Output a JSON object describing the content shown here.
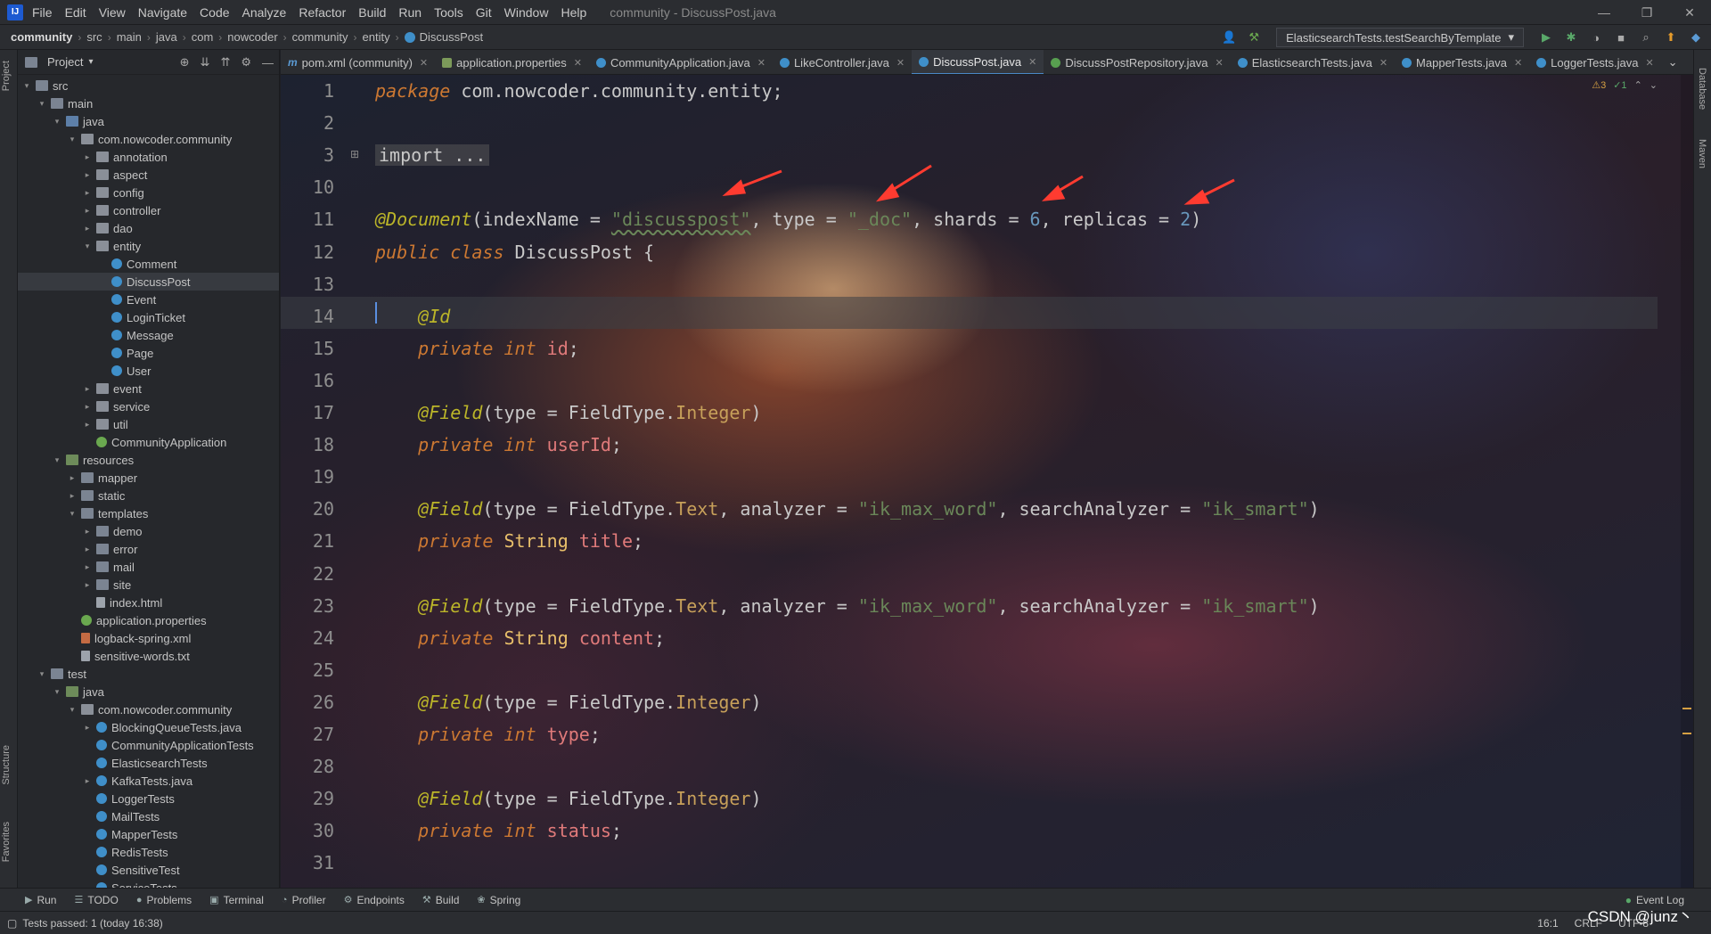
{
  "menu": {
    "items": [
      "File",
      "Edit",
      "View",
      "Navigate",
      "Code",
      "Analyze",
      "Refactor",
      "Build",
      "Run",
      "Tools",
      "Git",
      "Window",
      "Help"
    ],
    "title": "community - DiscussPost.java"
  },
  "breadcrumb": [
    "community",
    "src",
    "main",
    "java",
    "com",
    "nowcoder",
    "community",
    "entity",
    "DiscussPost"
  ],
  "run_config": "ElasticsearchTests.testSearchByTemplate",
  "project_panel": {
    "title": "Project",
    "tree": [
      {
        "label": "src",
        "indent": 0,
        "arrow": "▾",
        "icon": "folder"
      },
      {
        "label": "main",
        "indent": 1,
        "arrow": "▾",
        "icon": "folder"
      },
      {
        "label": "java",
        "indent": 2,
        "arrow": "▾",
        "icon": "src"
      },
      {
        "label": "com.nowcoder.community",
        "indent": 3,
        "arrow": "▾",
        "icon": "pkg"
      },
      {
        "label": "annotation",
        "indent": 4,
        "arrow": "▸",
        "icon": "pkg"
      },
      {
        "label": "aspect",
        "indent": 4,
        "arrow": "▸",
        "icon": "pkg"
      },
      {
        "label": "config",
        "indent": 4,
        "arrow": "▸",
        "icon": "pkg"
      },
      {
        "label": "controller",
        "indent": 4,
        "arrow": "▸",
        "icon": "pkg"
      },
      {
        "label": "dao",
        "indent": 4,
        "arrow": "▸",
        "icon": "pkg"
      },
      {
        "label": "entity",
        "indent": 4,
        "arrow": "▾",
        "icon": "pkg"
      },
      {
        "label": "Comment",
        "indent": 5,
        "arrow": "",
        "icon": "class"
      },
      {
        "label": "DiscussPost",
        "indent": 5,
        "arrow": "",
        "icon": "class",
        "selected": true
      },
      {
        "label": "Event",
        "indent": 5,
        "arrow": "",
        "icon": "class"
      },
      {
        "label": "LoginTicket",
        "indent": 5,
        "arrow": "",
        "icon": "class"
      },
      {
        "label": "Message",
        "indent": 5,
        "arrow": "",
        "icon": "class"
      },
      {
        "label": "Page",
        "indent": 5,
        "arrow": "",
        "icon": "class"
      },
      {
        "label": "User",
        "indent": 5,
        "arrow": "",
        "icon": "class"
      },
      {
        "label": "event",
        "indent": 4,
        "arrow": "▸",
        "icon": "pkg"
      },
      {
        "label": "service",
        "indent": 4,
        "arrow": "▸",
        "icon": "pkg"
      },
      {
        "label": "util",
        "indent": 4,
        "arrow": "▸",
        "icon": "pkg"
      },
      {
        "label": "CommunityApplication",
        "indent": 4,
        "arrow": "",
        "icon": "spring"
      },
      {
        "label": "resources",
        "indent": 2,
        "arrow": "▾",
        "icon": "res"
      },
      {
        "label": "mapper",
        "indent": 3,
        "arrow": "▸",
        "icon": "folder"
      },
      {
        "label": "static",
        "indent": 3,
        "arrow": "▸",
        "icon": "folder"
      },
      {
        "label": "templates",
        "indent": 3,
        "arrow": "▾",
        "icon": "folder"
      },
      {
        "label": "demo",
        "indent": 4,
        "arrow": "▸",
        "icon": "folder"
      },
      {
        "label": "error",
        "indent": 4,
        "arrow": "▸",
        "icon": "folder"
      },
      {
        "label": "mail",
        "indent": 4,
        "arrow": "▸",
        "icon": "folder"
      },
      {
        "label": "site",
        "indent": 4,
        "arrow": "▸",
        "icon": "folder"
      },
      {
        "label": "index.html",
        "indent": 4,
        "arrow": "",
        "icon": "file"
      },
      {
        "label": "application.properties",
        "indent": 3,
        "arrow": "",
        "icon": "spring"
      },
      {
        "label": "logback-spring.xml",
        "indent": 3,
        "arrow": "",
        "icon": "xml"
      },
      {
        "label": "sensitive-words.txt",
        "indent": 3,
        "arrow": "",
        "icon": "file"
      },
      {
        "label": "test",
        "indent": 1,
        "arrow": "▾",
        "icon": "folder"
      },
      {
        "label": "java",
        "indent": 2,
        "arrow": "▾",
        "icon": "res"
      },
      {
        "label": "com.nowcoder.community",
        "indent": 3,
        "arrow": "▾",
        "icon": "pkg"
      },
      {
        "label": "BlockingQueueTests.java",
        "indent": 4,
        "arrow": "▸",
        "icon": "class"
      },
      {
        "label": "CommunityApplicationTests",
        "indent": 4,
        "arrow": "",
        "icon": "class"
      },
      {
        "label": "ElasticsearchTests",
        "indent": 4,
        "arrow": "",
        "icon": "class"
      },
      {
        "label": "KafkaTests.java",
        "indent": 4,
        "arrow": "▸",
        "icon": "class"
      },
      {
        "label": "LoggerTests",
        "indent": 4,
        "arrow": "",
        "icon": "class"
      },
      {
        "label": "MailTests",
        "indent": 4,
        "arrow": "",
        "icon": "class"
      },
      {
        "label": "MapperTests",
        "indent": 4,
        "arrow": "",
        "icon": "class"
      },
      {
        "label": "RedisTests",
        "indent": 4,
        "arrow": "",
        "icon": "class"
      },
      {
        "label": "SensitiveTest",
        "indent": 4,
        "arrow": "",
        "icon": "class"
      },
      {
        "label": "ServiceTests",
        "indent": 4,
        "arrow": "",
        "icon": "class"
      }
    ]
  },
  "tabs": [
    {
      "label": "pom.xml (community)",
      "icon": "m"
    },
    {
      "label": "application.properties",
      "icon": "p"
    },
    {
      "label": "CommunityApplication.java",
      "icon": "c"
    },
    {
      "label": "LikeController.java",
      "icon": "c"
    },
    {
      "label": "DiscussPost.java",
      "icon": "c",
      "active": true
    },
    {
      "label": "DiscussPostRepository.java",
      "icon": "i"
    },
    {
      "label": "ElasticsearchTests.java",
      "icon": "c"
    },
    {
      "label": "MapperTests.java",
      "icon": "c"
    },
    {
      "label": "LoggerTests.java",
      "icon": "c"
    }
  ],
  "editor": {
    "warnings": "⚠3",
    "weak_warnings": "✓1",
    "line_numbers": [
      "1",
      "2",
      "3",
      "10",
      "11",
      "12",
      "13",
      "14",
      "15",
      "16",
      "17",
      "18",
      "19",
      "20",
      "21",
      "22",
      "23",
      "24",
      "25",
      "26",
      "27",
      "28",
      "29",
      "30",
      "31"
    ],
    "lines": [
      [
        [
          "kw",
          "package"
        ],
        [
          "p",
          " com.nowcoder.community.entity;"
        ]
      ],
      [],
      [
        [
          "fold",
          "import ..."
        ]
      ],
      [],
      [
        [
          "ann",
          "@Document"
        ],
        [
          "p",
          "(indexName = "
        ],
        [
          "sq",
          "\"discusspost\""
        ],
        [
          "p",
          ", type = "
        ],
        [
          "str",
          "\"_doc\""
        ],
        [
          "p",
          ", shards = "
        ],
        [
          "num",
          "6"
        ],
        [
          "p",
          ", replicas = "
        ],
        [
          "num",
          "2"
        ],
        [
          "p",
          ")"
        ]
      ],
      [
        [
          "kw",
          "public class"
        ],
        [
          "p",
          " DiscussPost {"
        ]
      ],
      [],
      [
        [
          "p",
          "    "
        ],
        [
          "ann",
          "@Id"
        ]
      ],
      [
        [
          "p",
          "    "
        ],
        [
          "kw",
          "private int"
        ],
        [
          "p",
          " "
        ],
        [
          "fld",
          "id"
        ],
        [
          "p",
          ";"
        ]
      ],
      [],
      [
        [
          "p",
          "    "
        ],
        [
          "ann",
          "@Field"
        ],
        [
          "p",
          "(type = FieldType."
        ],
        [
          "enumc",
          "Integer"
        ],
        [
          "p",
          ")"
        ]
      ],
      [
        [
          "p",
          "    "
        ],
        [
          "kw",
          "private int"
        ],
        [
          "p",
          " "
        ],
        [
          "fld",
          "userId"
        ],
        [
          "p",
          ";"
        ]
      ],
      [],
      [
        [
          "p",
          "    "
        ],
        [
          "ann",
          "@Field"
        ],
        [
          "p",
          "(type = FieldType."
        ],
        [
          "enumc",
          "Text"
        ],
        [
          "p",
          ", analyzer = "
        ],
        [
          "str",
          "\"ik_max_word\""
        ],
        [
          "p",
          ", searchAnalyzer = "
        ],
        [
          "str",
          "\"ik_smart\""
        ],
        [
          "p",
          ")"
        ]
      ],
      [
        [
          "p",
          "    "
        ],
        [
          "kw",
          "private"
        ],
        [
          "p",
          " "
        ],
        [
          "cls",
          "String"
        ],
        [
          "p",
          " "
        ],
        [
          "fld",
          "title"
        ],
        [
          "p",
          ";"
        ]
      ],
      [],
      [
        [
          "p",
          "    "
        ],
        [
          "ann",
          "@Field"
        ],
        [
          "p",
          "(type = FieldType."
        ],
        [
          "enumc",
          "Text"
        ],
        [
          "p",
          ", analyzer = "
        ],
        [
          "str",
          "\"ik_max_word\""
        ],
        [
          "p",
          ", searchAnalyzer = "
        ],
        [
          "str",
          "\"ik_smart\""
        ],
        [
          "p",
          ")"
        ]
      ],
      [
        [
          "p",
          "    "
        ],
        [
          "kw",
          "private"
        ],
        [
          "p",
          " "
        ],
        [
          "cls",
          "String"
        ],
        [
          "p",
          " "
        ],
        [
          "fld",
          "content"
        ],
        [
          "p",
          ";"
        ]
      ],
      [],
      [
        [
          "p",
          "    "
        ],
        [
          "ann",
          "@Field"
        ],
        [
          "p",
          "(type = FieldType."
        ],
        [
          "enumc",
          "Integer"
        ],
        [
          "p",
          ")"
        ]
      ],
      [
        [
          "p",
          "    "
        ],
        [
          "kw",
          "private int"
        ],
        [
          "p",
          " "
        ],
        [
          "fld",
          "type"
        ],
        [
          "p",
          ";"
        ]
      ],
      [],
      [
        [
          "p",
          "    "
        ],
        [
          "ann",
          "@Field"
        ],
        [
          "p",
          "(type = FieldType."
        ],
        [
          "enumc",
          "Integer"
        ],
        [
          "p",
          ")"
        ]
      ],
      [
        [
          "p",
          "    "
        ],
        [
          "kw",
          "private int"
        ],
        [
          "p",
          " "
        ],
        [
          "fld",
          "status"
        ],
        [
          "p",
          ";"
        ]
      ],
      []
    ]
  },
  "bottom_tools": [
    {
      "label": "Run",
      "icon": "▶"
    },
    {
      "label": "TODO",
      "icon": "☰"
    },
    {
      "label": "Problems",
      "icon": "●"
    },
    {
      "label": "Terminal",
      "icon": "▣"
    },
    {
      "label": "Profiler",
      "icon": "◔"
    },
    {
      "label": "Endpoints",
      "icon": "⚙"
    },
    {
      "label": "Build",
      "icon": "⚒"
    },
    {
      "label": "Spring",
      "icon": "❀"
    }
  ],
  "event_log": "Event Log",
  "status": {
    "message": "Tests passed: 1 (today 16:38)",
    "position": "16:1",
    "line_sep": "CRLF",
    "encoding": "UTF-8"
  },
  "watermark": "CSDN @junz丶",
  "side_tabs": {
    "left": [
      "Project",
      "Structure",
      "Favorites"
    ],
    "right": [
      "Database",
      "Maven"
    ]
  },
  "colors": {
    "keyword": "#cc7832",
    "annotation": "#bbb529",
    "string": "#6a8759",
    "number": "#6897bb",
    "field": "#e07a7a",
    "accent": "#4a88c7"
  }
}
